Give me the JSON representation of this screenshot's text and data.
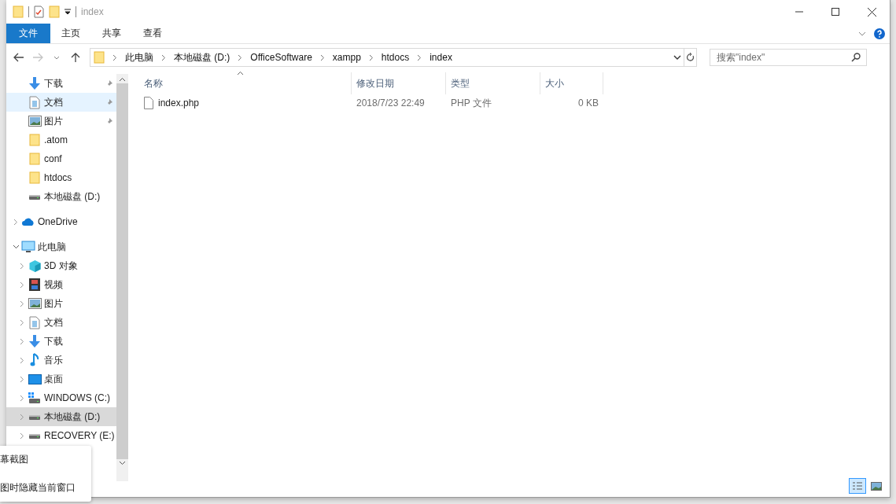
{
  "window": {
    "title": "index"
  },
  "ribbon_tabs": [
    {
      "label": "文件",
      "kind": "file"
    },
    {
      "label": "主页",
      "kind": "tab"
    },
    {
      "label": "共享",
      "kind": "tab"
    },
    {
      "label": "查看",
      "kind": "tab"
    }
  ],
  "address": {
    "crumbs": [
      "此电脑",
      "本地磁盘 (D:)",
      "OfficeSoftware",
      "xampp",
      "htdocs",
      "index"
    ],
    "forward_disabled": true
  },
  "search": {
    "placeholder": "搜索\"index\""
  },
  "quick_access": [
    {
      "label": "下载",
      "kind": "download",
      "pinned": true,
      "hover": false,
      "selected": false
    },
    {
      "label": "文档",
      "kind": "document",
      "pinned": true,
      "hover": true,
      "selected": false
    },
    {
      "label": "图片",
      "kind": "picture",
      "pinned": true,
      "hover": false,
      "selected": false
    },
    {
      "label": ".atom",
      "kind": "folder",
      "pinned": false,
      "hover": false,
      "selected": false
    },
    {
      "label": "conf",
      "kind": "folder",
      "pinned": false,
      "hover": false,
      "selected": false
    },
    {
      "label": "htdocs",
      "kind": "folder",
      "pinned": false,
      "hover": false,
      "selected": false
    },
    {
      "label": "本地磁盘 (D:)",
      "kind": "drive",
      "pinned": false,
      "hover": false,
      "selected": false
    }
  ],
  "nav": [
    {
      "label": "OneDrive",
      "kind": "cloud",
      "expanded": false,
      "selected": false
    },
    {
      "label": "此电脑",
      "kind": "pc",
      "expanded": true,
      "selected": false,
      "children": [
        {
          "label": "3D 对象",
          "kind": "cube",
          "expanded": false,
          "selected": false
        },
        {
          "label": "视频",
          "kind": "video",
          "expanded": false,
          "selected": false
        },
        {
          "label": "图片",
          "kind": "picture",
          "expanded": false,
          "selected": false
        },
        {
          "label": "文档",
          "kind": "document",
          "expanded": false,
          "selected": false
        },
        {
          "label": "下载",
          "kind": "download",
          "expanded": false,
          "selected": false
        },
        {
          "label": "音乐",
          "kind": "music",
          "expanded": false,
          "selected": false
        },
        {
          "label": "桌面",
          "kind": "desktop",
          "expanded": false,
          "selected": false
        },
        {
          "label": "WINDOWS (C:)",
          "kind": "windrive",
          "expanded": false,
          "selected": false
        },
        {
          "label": "本地磁盘 (D:)",
          "kind": "drive",
          "expanded": false,
          "selected": true
        },
        {
          "label": "RECOVERY (E:)",
          "kind": "drive",
          "expanded": false,
          "selected": false
        }
      ]
    }
  ],
  "table": {
    "columns": [
      {
        "label": "名称",
        "sorted": true
      },
      {
        "label": "修改日期",
        "sorted": false
      },
      {
        "label": "类型",
        "sorted": false
      },
      {
        "label": "大小",
        "sorted": false
      }
    ],
    "rows": [
      {
        "name": "index.php",
        "date": "2018/7/23 22:49",
        "type": "PHP 文件",
        "size": "0 KB"
      }
    ]
  },
  "view_buttons": [
    {
      "kind": "details",
      "selected": true
    },
    {
      "kind": "large",
      "selected": false
    }
  ],
  "popup": {
    "lines": [
      "幕截图",
      "图时隐藏当前窗口"
    ]
  }
}
